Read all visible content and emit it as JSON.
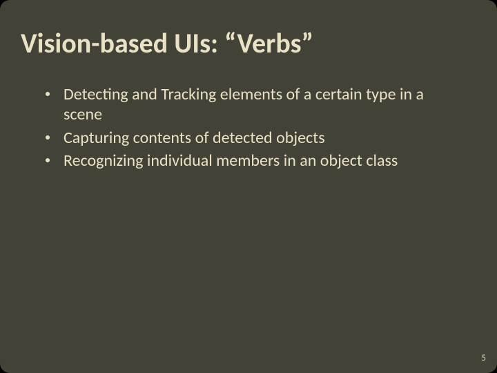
{
  "title": "Vision-based UIs: “Verbs”",
  "bullets": [
    "Detecting and Tracking elements of a certain type in a scene",
    "Capturing contents of detected objects",
    "Recognizing individual members in an object class"
  ],
  "page_number": "5"
}
